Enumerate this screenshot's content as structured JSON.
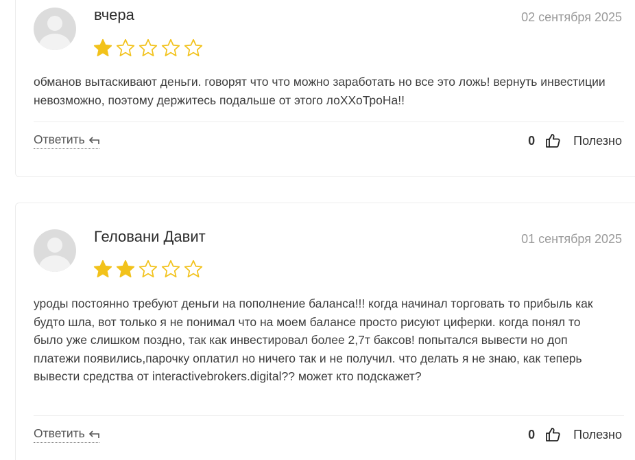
{
  "reviews": [
    {
      "author": "вчера",
      "date": "02 сентября 2025",
      "rating": 1,
      "max_rating": 5,
      "text": "обманов вытаскивают деньги. говорят что что можно заработать но все это ложь! вернуть инвестиции невозможно, поэтому держитесь подальше от этого лоХХоТроНа!!",
      "reply_label": "Ответить",
      "likes": "0",
      "useful_label": "Полезно"
    },
    {
      "author": "Геловани Давит",
      "date": "01 сентября 2025",
      "rating": 2,
      "max_rating": 5,
      "text": "уроды постоянно требуют деньги на пополнение баланса!!! когда начинал торговать то прибыль как будто шла, вот только я не понимал что на моем балансе просто рисуют циферки. когда понял то было уже слишком поздно, так как инвестировал более 2,7т баксов! попытался вывести но доп платежи появились,парочку оплатил но ничего так и не получил. что делать я не знаю, как теперь вывести средства от interactivebrokers.digital?? может кто подскажет?",
      "reply_label": "Ответить",
      "likes": "0",
      "useful_label": "Полезно"
    }
  ],
  "colors": {
    "star_filled": "#f2c21b",
    "star_empty_stroke": "#f2c21b",
    "date": "#9a9a9a",
    "border": "#ececec"
  },
  "icons": {
    "avatar": "default-user-avatar-icon",
    "star": "star-icon",
    "reply": "reply-arrow-icon",
    "like": "thumbs-up-icon"
  }
}
